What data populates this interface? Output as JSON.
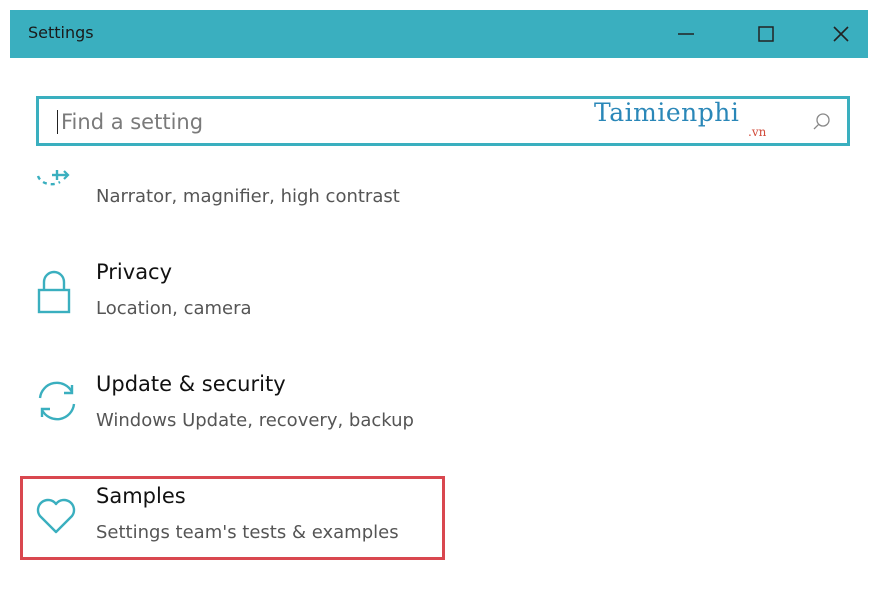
{
  "window": {
    "title": "Settings",
    "accent_color": "#3aafbf"
  },
  "search": {
    "placeholder": "Find a setting",
    "icon": "search-icon"
  },
  "watermark": {
    "text": "Taimienphi",
    "suffix": ".vn"
  },
  "items": [
    {
      "icon": "ease-of-access-icon",
      "title": "",
      "subtitle": "Narrator, magnifier, high contrast"
    },
    {
      "icon": "lock-icon",
      "title": "Privacy",
      "subtitle": "Location, camera"
    },
    {
      "icon": "sync-icon",
      "title": "Update & security",
      "subtitle": "Windows Update, recovery, backup"
    },
    {
      "icon": "heart-icon",
      "title": "Samples",
      "subtitle": "Settings team's tests & examples"
    }
  ],
  "highlight_color": "#d9474f"
}
